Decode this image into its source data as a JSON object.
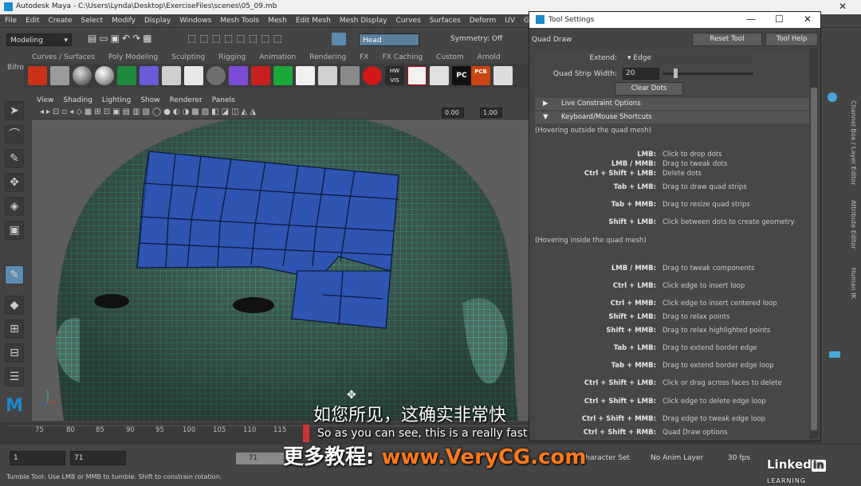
{
  "window": {
    "title": "Autodesk Maya - C:\\Users\\Lynda\\Desktop\\ExerciseFiles\\scenes\\05_09.mb"
  },
  "menubar": [
    "File",
    "Edit",
    "Create",
    "Select",
    "Modify",
    "Display",
    "Windows",
    "Mesh Tools",
    "Mesh",
    "Edit Mesh",
    "Mesh Display",
    "Curves",
    "Surfaces",
    "Deform",
    "UV",
    "Generat"
  ],
  "status": {
    "mode": "Modeling",
    "object_field": "Head",
    "symmetry": "Symmetry: Off"
  },
  "shelf_tabs": [
    "Curves / Surfaces",
    "Poly Modeling",
    "Sculpting",
    "Rigging",
    "Animation",
    "Rendering",
    "FX",
    "FX Caching",
    "Custom",
    "Arnold",
    "Bifrost"
  ],
  "shelf_icon_labels": {
    "hw": "HW",
    "vis": "VIS",
    "pc": "PC",
    "pcb": "PCB"
  },
  "panel_menu": [
    "View",
    "Shading",
    "Lighting",
    "Show",
    "Renderer",
    "Panels"
  ],
  "panel_fields": {
    "value1": "0.00",
    "value2": "1.00"
  },
  "tool_settings": {
    "window_title": "Tool Settings",
    "tool_name": "Quad Draw",
    "reset_label": "Reset Tool",
    "help_label": "Tool Help",
    "extend_label": "Extend:",
    "extend_value": "Edge",
    "strip_label": "Quad Strip Width:",
    "strip_value": "20",
    "clear_label": "Clear Dots",
    "sections": {
      "live": "Live Constraint Options",
      "keyboard": "Keyboard/Mouse Shortcuts"
    },
    "outside_header": "(Hovering outside the quad mesh)",
    "inside_header": "(Hovering inside the quad mesh)",
    "outside": [
      {
        "key": "LMB:",
        "desc": "Click to drop dots"
      },
      {
        "key": "LMB / MMB:",
        "desc": "Drag to tweak dots"
      },
      {
        "key": "Ctrl + Shift + LMB:",
        "desc": "Delete dots"
      },
      {
        "key": "Tab + LMB:",
        "desc": "Drag to draw quad strips"
      },
      {
        "key": "Tab + MMB:",
        "desc": "Drag to resize quad strips"
      },
      {
        "key": "Shift + LMB:",
        "desc": "Click between dots to create geometry"
      }
    ],
    "inside": [
      {
        "key": "LMB / MMB:",
        "desc": "Drag to tweak components"
      },
      {
        "key": "Ctrl + LMB:",
        "desc": "Click edge to insert loop"
      },
      {
        "key": "Ctrl + MMB:",
        "desc": "Click edge to insert centered loop"
      },
      {
        "key": "Shift + LMB:",
        "desc": "Drag to relax points"
      },
      {
        "key": "Shift + MMB:",
        "desc": "Drag to relax highlighted points"
      },
      {
        "key": "Tab + LMB:",
        "desc": "Drag to extend border edge"
      },
      {
        "key": "Tab + MMB:",
        "desc": "Drag to extend border edge loop"
      },
      {
        "key": "Ctrl + Shift + LMB:",
        "desc": "Click or drag across faces to delete"
      },
      {
        "key": "Ctrl + Shift + LMB:",
        "desc": "Click edge to delete edge loop"
      },
      {
        "key": "Ctrl + Shift + MMB:",
        "desc": "Drag edge to tweak edge loop"
      },
      {
        "key": "Ctrl + Shift + RMB:",
        "desc": "Quad Draw options"
      }
    ]
  },
  "right_tabs": [
    "Channel Box / Layer Editor",
    "Attribute Editor",
    "Human IK"
  ],
  "timeline": {
    "ticks": [
      "75",
      "80",
      "85",
      "90",
      "95",
      "100",
      "105",
      "110",
      "115"
    ]
  },
  "range": {
    "start": "1",
    "current": "71",
    "anim_current": "71",
    "character_set": "Character Set",
    "anim_layer": "No Anim Layer",
    "fps": "30 fps"
  },
  "helpline": "Tumble Tool: Use LMB or MMB to tumble. Shift to constrain rotation.",
  "subtitles": {
    "cn": "如您所见，这确实非常快",
    "en": "So as you can see, this is a really fast",
    "promo_prefix": "更多教程:",
    "promo_url": "www.VeryCG.com"
  },
  "watermark": {
    "brand": "Linked",
    "brand_in": "in",
    "suffix": "LEARNING"
  },
  "colors": {
    "accent": "#1b8ac9",
    "mesh_blue": "#2f55b3",
    "wire_green": "#27d6a0",
    "url": "#ff7a1a"
  }
}
